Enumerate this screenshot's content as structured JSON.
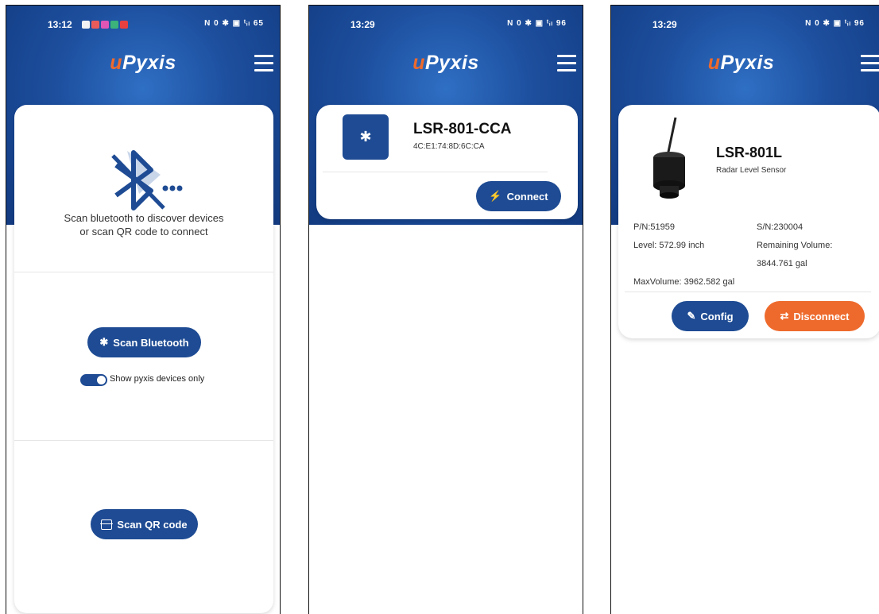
{
  "app": {
    "logo_u": "u",
    "logo_rest": "Pyxis"
  },
  "screen1": {
    "time": "13:12",
    "status_right": "N 0 ✱ ▣ ᵗᵢₗ 65",
    "message_line1": "Scan bluetooth to discover devices",
    "message_line2": "or scan QR code to connect",
    "scan_bluetooth_label": "Scan Bluetooth",
    "toggle_label": "Show pyxis devices only",
    "scan_qr_label": "Scan QR code"
  },
  "screen2": {
    "time": "13:29",
    "status_right": "N 0 ✱ ▣ ᵗᵢₗ 96",
    "device_name": "LSR-801-CCA",
    "device_mac": "4C:E1:74:8D:6C:CA",
    "connect_label": "Connect"
  },
  "screen3": {
    "time": "13:29",
    "status_right": "N 0 ✱ ▣ ᵗᵢₗ 96",
    "device_name": "LSR-801L",
    "device_type": "Radar Level Sensor",
    "pn": "P/N:51959",
    "sn": "S/N:230004",
    "level": "Level: 572.99 inch",
    "remaining_label": "Remaining Volume:",
    "remaining_value": "3844.761 gal",
    "max_volume": "MaxVolume: 3962.582 gal",
    "config_label": "Config",
    "disconnect_label": "Disconnect"
  },
  "colors": {
    "primary": "#1e4b93",
    "accent": "#ee6a2c"
  }
}
